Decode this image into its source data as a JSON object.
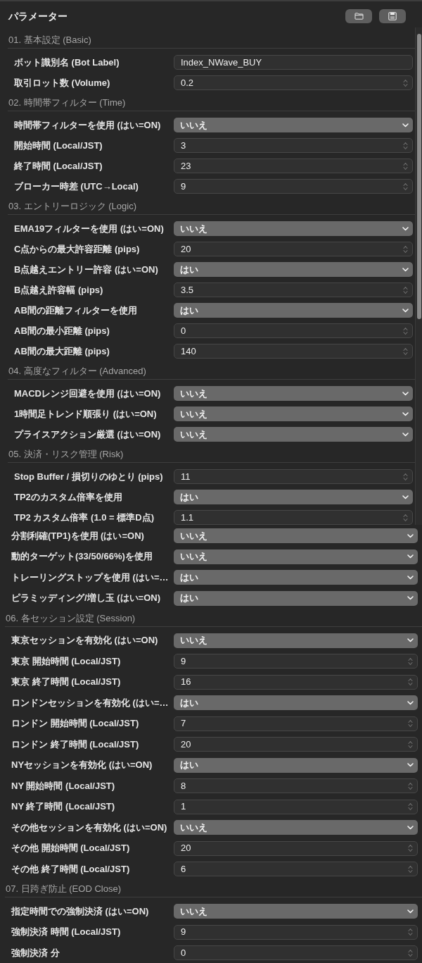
{
  "title": "パラメーター",
  "scroll_view": {
    "sections": [
      {
        "title": "01. 基本設定 (Basic)",
        "fields": [
          {
            "kind": "text",
            "label": "ボット識別名 (Bot Label)",
            "value": "Index_NWave_BUY"
          },
          {
            "kind": "number",
            "label": "取引ロット数 (Volume)",
            "value": "0.2"
          }
        ]
      },
      {
        "title": "02. 時間帯フィルター (Time)",
        "fields": [
          {
            "kind": "select",
            "label": "時間帯フィルターを使用 (はい=ON)",
            "value": "いいえ"
          },
          {
            "kind": "number",
            "label": "開始時間 (Local/JST)",
            "value": "3"
          },
          {
            "kind": "number",
            "label": "終了時間 (Local/JST)",
            "value": "23"
          },
          {
            "kind": "number",
            "label": "ブローカー時差 (UTC→Local)",
            "value": "9"
          }
        ]
      },
      {
        "title": "03. エントリーロジック (Logic)",
        "fields": [
          {
            "kind": "select",
            "label": "EMA19フィルターを使用 (はい=ON)",
            "value": "いいえ"
          },
          {
            "kind": "number",
            "label": "C点からの最大許容距離 (pips)",
            "value": "20"
          },
          {
            "kind": "select",
            "label": "B点越えエントリー許容 (はい=ON)",
            "value": "はい"
          },
          {
            "kind": "number",
            "label": "B点越え許容幅 (pips)",
            "value": "3.5"
          },
          {
            "kind": "select",
            "label": "AB間の距離フィルターを使用",
            "value": "はい"
          },
          {
            "kind": "number",
            "label": "AB間の最小距離 (pips)",
            "value": "0"
          },
          {
            "kind": "number",
            "label": "AB間の最大距離 (pips)",
            "value": "140"
          }
        ]
      },
      {
        "title": "04. 高度なフィルター (Advanced)",
        "fields": [
          {
            "kind": "select",
            "label": "MACDレンジ回避を使用 (はい=ON)",
            "value": "いいえ"
          },
          {
            "kind": "select",
            "label": "1時間足トレンド順張り (はい=ON)",
            "value": "いいえ"
          },
          {
            "kind": "select",
            "label": "プライスアクション厳選 (はい=ON)",
            "value": "いいえ"
          }
        ]
      },
      {
        "title": "05. 決済・リスク管理 (Risk)",
        "fields": [
          {
            "kind": "number",
            "label": "Stop Buffer / 損切りのゆとり (pips)",
            "value": "11"
          },
          {
            "kind": "select",
            "label": "TP2のカスタム倍率を使用",
            "value": "はい"
          },
          {
            "kind": "number",
            "label": "TP2 カスタム倍率 (1.0 = 標準D点)",
            "value": "1.1"
          }
        ]
      }
    ]
  },
  "overflow": {
    "fields": [
      {
        "kind": "select",
        "label": "分割利確(TP1)を使用 (はい=ON)",
        "value": "いいえ"
      },
      {
        "kind": "select",
        "label": "動的ターゲット(33/50/66%)を使用",
        "value": "いいえ"
      },
      {
        "kind": "select",
        "label": "トレーリングストップを使用 (はい=…",
        "value": "はい"
      },
      {
        "kind": "select",
        "label": "ピラミッディング/増し玉 (はい=ON)",
        "value": "はい"
      }
    ],
    "sections": [
      {
        "title": "06. 各セッション設定 (Session)",
        "fields": [
          {
            "kind": "select",
            "label": "東京セッションを有効化 (はい=ON)",
            "value": "いいえ"
          },
          {
            "kind": "number",
            "label": "東京 開始時間 (Local/JST)",
            "value": "9"
          },
          {
            "kind": "number",
            "label": "東京 終了時間 (Local/JST)",
            "value": "16"
          },
          {
            "kind": "select",
            "label": "ロンドンセッションを有効化 (はい=…",
            "value": "はい"
          },
          {
            "kind": "number",
            "label": "ロンドン 開始時間 (Local/JST)",
            "value": "7"
          },
          {
            "kind": "number",
            "label": "ロンドン 終了時間 (Local/JST)",
            "value": "20"
          },
          {
            "kind": "select",
            "label": "NYセッションを有効化 (はい=ON)",
            "value": "はい"
          },
          {
            "kind": "number",
            "label": "NY 開始時間 (Local/JST)",
            "value": "8"
          },
          {
            "kind": "number",
            "label": "NY 終了時間 (Local/JST)",
            "value": "1"
          },
          {
            "kind": "select",
            "label": "その他セッションを有効化 (はい=ON)",
            "value": "いいえ"
          },
          {
            "kind": "number",
            "label": "その他 開始時間 (Local/JST)",
            "value": "20"
          },
          {
            "kind": "number",
            "label": "その他 終了時間 (Local/JST)",
            "value": "6"
          }
        ]
      },
      {
        "title": "07. 日跨ぎ防止 (EOD Close)",
        "fields": [
          {
            "kind": "select",
            "label": "指定時間での強制決済 (はい=ON)",
            "value": "いいえ"
          },
          {
            "kind": "number",
            "label": "強制決済 時間 (Local/JST)",
            "value": "9"
          },
          {
            "kind": "number",
            "label": "強制決済 分",
            "value": "0"
          }
        ]
      }
    ]
  }
}
